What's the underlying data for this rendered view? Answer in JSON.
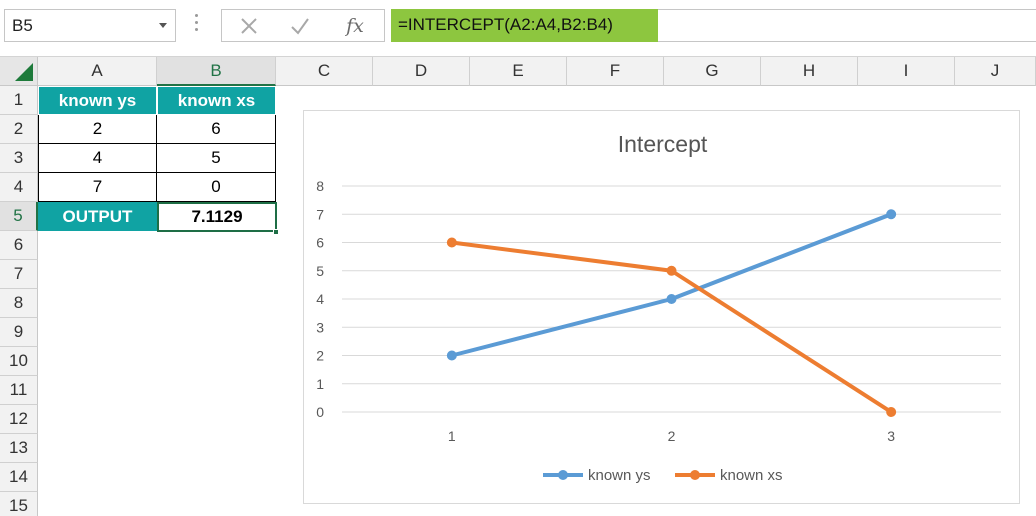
{
  "formula_bar": {
    "name_box": "B5",
    "formula": "=INTERCEPT(A2:A4,B2:B4)",
    "cancel_icon": "close-icon",
    "enter_icon": "check-icon",
    "fx_label": "fx"
  },
  "columns": [
    "A",
    "B",
    "C",
    "D",
    "E",
    "F",
    "G",
    "H",
    "I",
    "J"
  ],
  "rows": [
    "1",
    "2",
    "3",
    "4",
    "5",
    "6",
    "7",
    "8",
    "9",
    "10",
    "11",
    "12",
    "13",
    "14",
    "15"
  ],
  "selected_cell": "B5",
  "table": {
    "header": [
      "known ys",
      "known xs"
    ],
    "rows": [
      [
        "2",
        "6"
      ],
      [
        "4",
        "5"
      ],
      [
        "7",
        "0"
      ]
    ],
    "output_label": "OUTPUT",
    "output_value": "7.1129"
  },
  "colors": {
    "header_fill": "#10a3a3",
    "formula_highlight": "#8dc63f",
    "series_ys": "#5b9bd5",
    "series_xs": "#ed7d31"
  },
  "chart_data": {
    "type": "line",
    "title": "Intercept",
    "categories": [
      "1",
      "2",
      "3"
    ],
    "series": [
      {
        "name": "known ys",
        "values": [
          2,
          4,
          7
        ],
        "color": "#5b9bd5"
      },
      {
        "name": "known xs",
        "values": [
          6,
          5,
          0
        ],
        "color": "#ed7d31"
      }
    ],
    "ylim": [
      0,
      8
    ],
    "yticks": [
      "0",
      "1",
      "2",
      "3",
      "4",
      "5",
      "6",
      "7",
      "8"
    ],
    "grid": true,
    "legend": "bottom"
  }
}
